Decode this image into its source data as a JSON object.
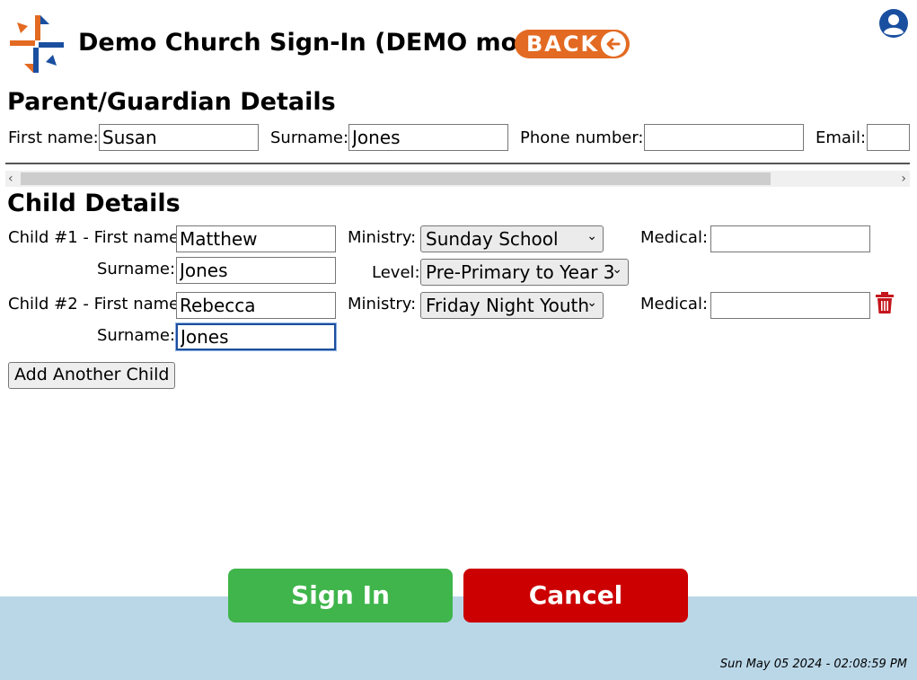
{
  "header": {
    "title": "Demo Church Sign-In (DEMO mode)",
    "back_label": "BACK"
  },
  "parent": {
    "heading": "Parent/Guardian Details",
    "first_name_label": "First name:",
    "first_name_value": "Susan",
    "surname_label": "Surname:",
    "surname_value": "Jones",
    "phone_label": "Phone number:",
    "phone_value": "",
    "email_label": "Email:",
    "email_value": ""
  },
  "children": {
    "heading": "Child Details",
    "child1": {
      "first_name_label": "Child #1 - First name:",
      "first_name_value": "Matthew",
      "surname_label": "Surname:",
      "surname_value": "Jones",
      "ministry_label": "Ministry:",
      "ministry_value": "Sunday School",
      "level_label": "Level:",
      "level_value": "Pre-Primary to Year 3",
      "medical_label": "Medical:",
      "medical_value": ""
    },
    "child2": {
      "first_name_label": "Child #2 - First name:",
      "first_name_value": "Rebecca",
      "surname_label": "Surname:",
      "surname_value": "Jones",
      "ministry_label": "Ministry:",
      "ministry_value": "Friday Night Youth",
      "medical_label": "Medical:",
      "medical_value": ""
    },
    "add_label": "Add Another Child"
  },
  "actions": {
    "sign_in_label": "Sign In",
    "cancel_label": "Cancel"
  },
  "footer": {
    "timestamp": "Sun May 05 2024 - 02:08:59 PM"
  },
  "icons": {
    "back": "arrow-left-icon",
    "user": "user-circle-icon",
    "delete": "trash-icon",
    "dropdown": "chevron-down-icon",
    "logo": "cross-logo"
  },
  "colors": {
    "back_button": "#e36a22",
    "sign_in": "#3fb54b",
    "cancel": "#cc0000",
    "footer": "#bad7e8",
    "user_icon": "#1a4fa0",
    "trash": "#c4161c"
  }
}
